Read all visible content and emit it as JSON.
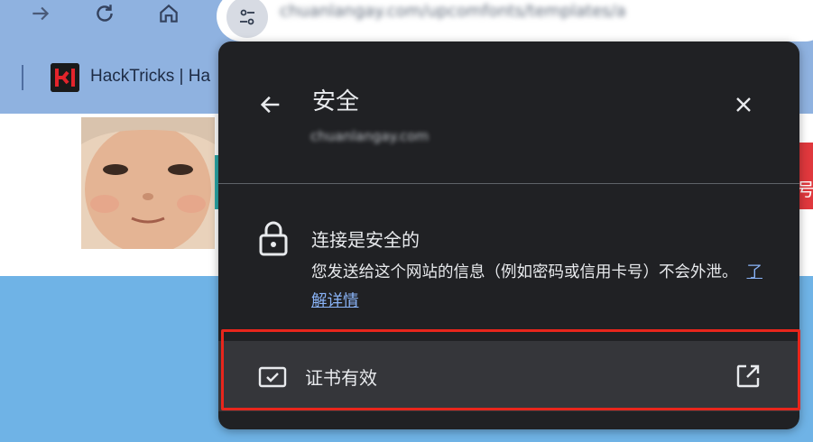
{
  "browser": {
    "url_text": "chuanlangay.com/upcomfonts/templates/a",
    "bookmarks": [
      {
        "label": "HackTricks | Ha"
      }
    ]
  },
  "icons": {
    "back_nav": "arrow-right-icon",
    "reload": "reload-icon",
    "home": "home-icon",
    "site_info": "tune-icon"
  },
  "page": {
    "red_block_char": "号"
  },
  "popup": {
    "title": "安全",
    "domain": "chuanlangay.com",
    "back_icon": "arrow-left-icon",
    "close_icon": "close-icon",
    "connection": {
      "title": "连接是安全的",
      "description": "您发送给这个网站的信息（例如密码或信用卡号）不会外泄。",
      "learn_more": "了解详情"
    },
    "certificate": {
      "label": "证书有效",
      "icon": "certificate-icon",
      "open_icon": "open-in-new-icon"
    }
  },
  "colors": {
    "popup_bg": "#202124",
    "row_bg": "#35363a",
    "link": "#8ab4f8",
    "highlight_border": "#e8261c",
    "browser_chrome": "#8fb2e0"
  }
}
